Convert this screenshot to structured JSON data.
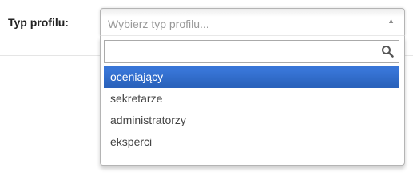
{
  "form": {
    "label": "Typ profilu:"
  },
  "select": {
    "placeholder": "Wybierz typ profilu...",
    "arrow_icon": "triangle-up-icon",
    "search": {
      "value": "",
      "icon": "search-icon"
    },
    "options": [
      {
        "label": "oceniający",
        "highlighted": true
      },
      {
        "label": "sekretarze",
        "highlighted": false
      },
      {
        "label": "administratorzy",
        "highlighted": false
      },
      {
        "label": "eksperci",
        "highlighted": false
      }
    ]
  },
  "colors": {
    "highlight": "#3875d7",
    "highlight_text": "#ffffff",
    "placeholder_text": "#999999",
    "border": "#b4b4b4"
  }
}
